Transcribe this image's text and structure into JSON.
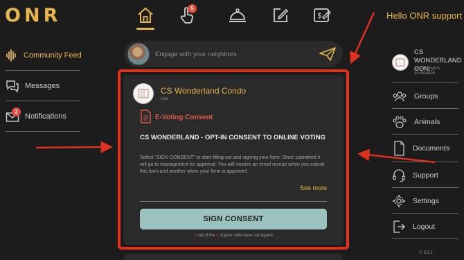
{
  "header": {
    "logo_letters": [
      "O",
      "N",
      "R"
    ],
    "greeting": "Hello ONR support",
    "nav": [
      {
        "name": "home",
        "icon": "home-icon",
        "active": true
      },
      {
        "name": "tap",
        "icon": "hand-tap-icon",
        "badge": "5"
      },
      {
        "name": "concierge",
        "icon": "service-bell-icon"
      },
      {
        "name": "edit",
        "icon": "edit-square-icon"
      },
      {
        "name": "payments",
        "icon": "invoice-pen-icon"
      }
    ]
  },
  "left_nav": {
    "items": [
      {
        "label": "Community Feed",
        "icon": "sound-wave-icon",
        "active": true
      },
      {
        "label": "Messages",
        "icon": "chat-bubbles-icon"
      },
      {
        "label": "Notifications",
        "icon": "envelope-icon",
        "badge": "2"
      }
    ]
  },
  "composer": {
    "placeholder": "Engage with your neighbors"
  },
  "post": {
    "author": "CS Wonderland Condo",
    "time": "now",
    "type_label": "E-Voting Consent",
    "title": "CS WONDERLAND - OPT-IN CONSENT TO ONLINE VOTING",
    "body": "Select \"SIGN CONSENT\" to start filling out and signing your form. Once submitted it will go to management for approval. You will receive an email receipt when you submit this form and another when your form is approved.",
    "see_more": "See more",
    "button_label": "SIGN CONSENT",
    "units_count": "1",
    "units_total": "1",
    "units_mid": " out of the ",
    "units_end": " of your units have not signed"
  },
  "right_nav": {
    "association_name": "CS WONDERLAND CON...",
    "association_sub": "Add or Switch association",
    "items": [
      {
        "label": "Groups",
        "icon": "group-icon"
      },
      {
        "label": "Animals",
        "icon": "paw-icon"
      },
      {
        "label": "Documents",
        "icon": "document-icon"
      },
      {
        "label": "Support",
        "icon": "headset-icon"
      },
      {
        "label": "Settings",
        "icon": "gear-icon"
      },
      {
        "label": "Logout",
        "icon": "logout-icon"
      }
    ],
    "version": "V. 3.5.1"
  },
  "colors": {
    "accent": "#e7b64a",
    "annotation": "#e0311f",
    "button": "#9cc2bf",
    "background": "#1c1c1c"
  }
}
